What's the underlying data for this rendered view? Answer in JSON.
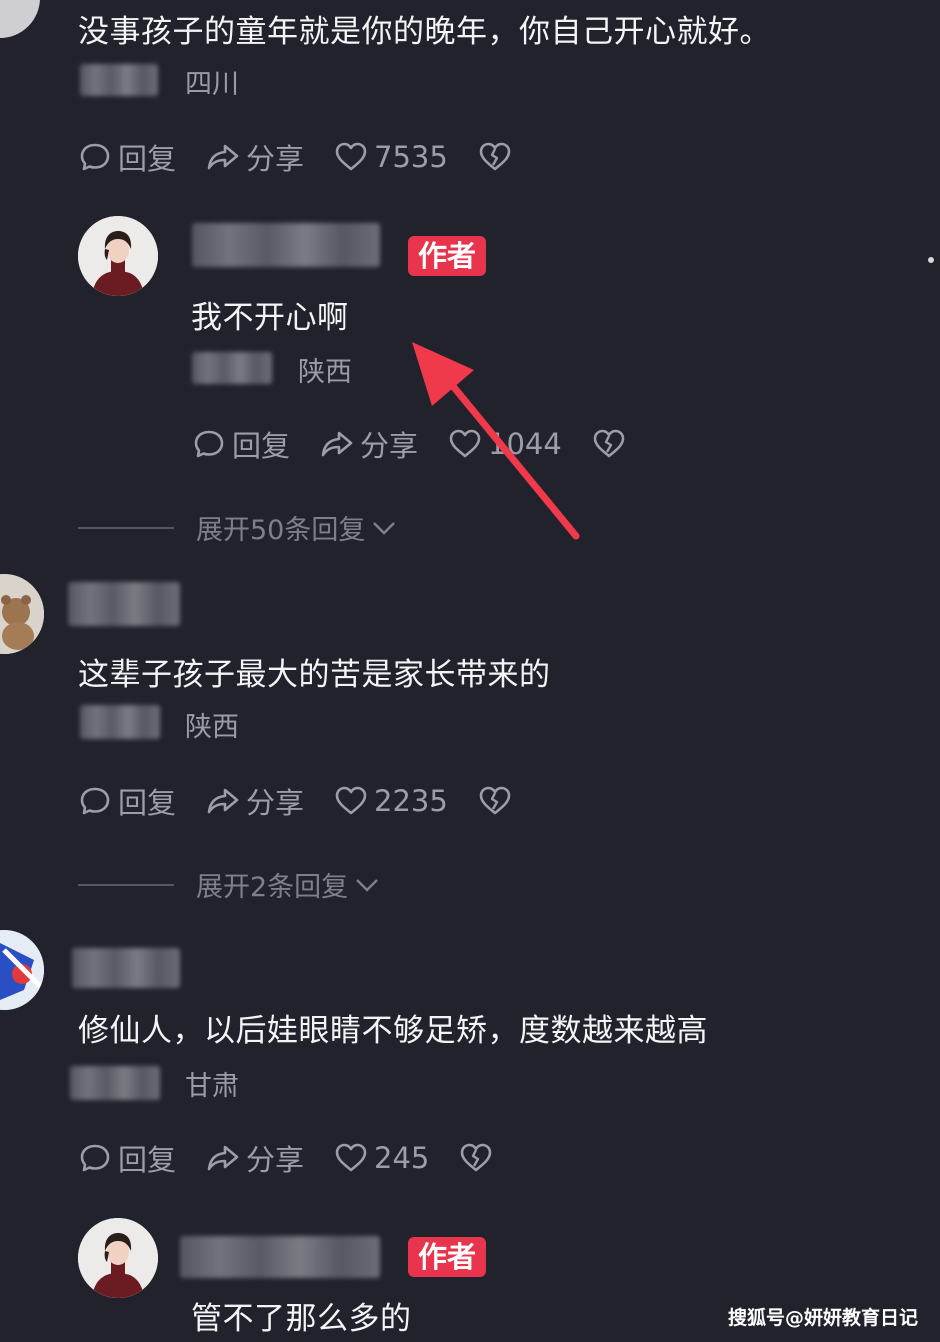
{
  "comments": [
    {
      "text": "没事孩子的童年就是你的晚年，你自己开心就好。",
      "location": "四川",
      "reply_label": "回复",
      "share_label": "分享",
      "likes": "7535"
    },
    {
      "author_badge": "作者",
      "text": "我不开心啊",
      "location": "陕西",
      "reply_label": "回复",
      "share_label": "分享",
      "likes": "1044",
      "expand_label": "展开50条回复"
    },
    {
      "text": "这辈子孩子最大的苦是家长带来的",
      "location": "陕西",
      "reply_label": "回复",
      "share_label": "分享",
      "likes": "2235",
      "expand_label": "展开2条回复"
    },
    {
      "text": "修仙人，以后娃眼睛不够足矫，度数越来越高",
      "location": "甘肃",
      "reply_label": "回复",
      "share_label": "分享",
      "likes": "245"
    },
    {
      "author_badge": "作者",
      "text": "管不了那么多的"
    }
  ],
  "colors": {
    "background": "#21222c",
    "badge": "#e8344d",
    "arrow": "#f0394b",
    "muted": "#9c9da5"
  },
  "watermark": "搜狐号@妍妍教育日记"
}
